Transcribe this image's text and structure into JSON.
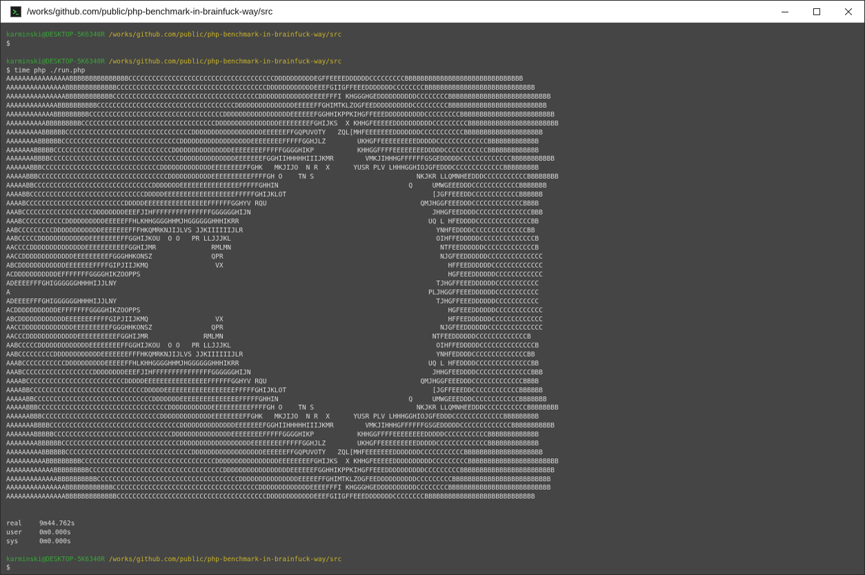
{
  "window": {
    "title": "/works/github.com/public/php-benchmark-in-brainfuck-way/src",
    "controls": [
      "minimize-icon",
      "maximize-icon",
      "close-icon"
    ]
  },
  "colors": {
    "prompt_user": "#3aa53a",
    "prompt_path": "#c9b42a",
    "text": "#d9d9d9",
    "background": "#454545"
  },
  "terminal": {
    "prompt1": {
      "user": "karminski@DESKTOP-5K6340R",
      "path": "/works/github.com/public/php-benchmark-in-brainfuck-way/src"
    },
    "prompt1_cmd": "$",
    "prompt2": {
      "user": "karminski@DESKTOP-5K6340R",
      "path": "/works/github.com/public/php-benchmark-in-brainfuck-way/src"
    },
    "prompt2_cmd": "$ time php ./run.php",
    "output": [
      "AAAAAAAAAAAAAAAABBBBBBBBBBBBBBBCCCCCCCCCCCCCCCCCCCCCCCCCCCCCCCCCCCCCDDDDDDDDDDEGFFEEEEDDDDDDCCCCCCCCCBBBBBBBBBBBBBBBBBBBBBBBBBBBBBB",
      "AAAAAAAAAAAAAAABBBBBBBBBBBBBCCCCCCCCCCCCCCCCCCCCCCCCCCCCCCCCCCCCCCDDDDDDDDDDDDEEEFGIIGFFEEEDDDDDDDCCCCCCCCBBBBBBBBBBBBBBBBBBBBBBBBBBBB",
      "AAAAAAAAAAAAAAABBBBBBBBBBBBCCCCCCCCCCCCCCCCCCCCCCCCCCCCCCCCCCCCCDDDDDDDDDDDDDEEEEFFFI KHGGGHGEDDDDDDDDDDCCCCCCCCBBBBBBBBBBBBBBBBBBBBBBBBBB",
      "AAAAAAAAAAAAABBBBBBBBBBCCCCCCCCCCCCCCCCCCCCCCCCCCCCCCCCCCCDDDDDDDDDDDDDDDEEEEEFFGHIMTKLZOGFEEDDDDDDDDDDCCCCCCCCCBBBBBBBBBBBBBBBBBBBBBBBBB",
      "AAAAAAAAAAAABBBBBBBBBCCCCCCCCCCCCCCCCCCCCCCCCCCCCCCCCCCDDDDDDDDDDDDDDDDDEEEEEEFGGHHIKPPKIHGFFEEEDDDDDDDDDDCCCCCCCCCBBBBBBBBBBBBBBBBBBBBBBBB",
      "AAAAAAAAAABBBBBBBBBCCCCCCCCCCCCCCCCCCCCCCCCCCCCCCCCCCDDDDDDDDDDDDDDDDEEEEEEEEFGHIJKS  X KHHGFEEEEEDDDDDDDDDDCCCCCCCCCBBBBBBBBBBBBBBBBBBBBBBB",
      "AAAAAAAAABBBBBBCCCCCCCCCCCCCCCCCCCCCCCCCCCCCCCCDDDDDDDDDDDDDDDDDDEEEEEEFFGQPUVOTY   ZQL[MHFEEEEEEEDDDDDDDCCCCCCCCCCCBBBBBBBBBBBBBBBBBBBB",
      "AAAAAAAABBBBBBCCCCCCCCCCCCCCCCCCCCCCCCCCCCCCDDDDDDDDDDDDDDDDDDEEEEEEEEFFFFFGGHJLZ        UKHGFFEEEEEEEEEDDDDDCCCCCCCCCCCCCBBBBBBBBBBBBB",
      "AAAAAAABBBBBCCCCCCCCCCCCCCCCCCCCCCCCCCCCCCDDDDDDDDDDDDDDDEEEEEEEEFFFFFGGGGHIKP           KHHGGFFFFEEEEEEEEDDDDDCCCCCCCCCCCBBBBBBBBBBBBB",
      "AAAAAAABBBBCCCCCCCCCCCCCCCCCCCCCCCCCCCCCCCCCDDDDDDDDDDDDDDEEEEEEEFGGHIIHHHHHIIIJKMR        VMKJIHHHGFFFFFFGSGEDDDDDCCCCCCCCCCCCCBBBBBBBBBBB",
      "AAAAAABBBCCCCCCCCCCCCCCCCCCCCCCCCCCCCCCDDDDDDDDDDDDDEEEEEEEEFFGHK   MKJIJO  N R  X      YUSR PLV LHHHGGHIOJGFEDDDCCCCCCCCCCCCCBBBBBBBBB",
      "AAAAABBBCCCCCCCCCCCCCCCCCCCCCCCCCCCCCCCCCDDDDDDDDDDDEEEEEEEEEEFFFFGH O    TN S                          NKJKR LLQMNHEEDDDCCCCCCCCCCCBBBBBBBB",
      "AAAAABBCCCCCCCCCCCCCCCCCCCCCCCCCCCCCCDDDDDDDEEEEEEEEEEEEEEEFFFFFGHHIN                                 Q     UMWGEEEDDDCCCCCCCCCCCCBBBBBBB",
      "AAAABBCCCCCCCCCCCCCCCCCCCCCCCCCCCCCDDDDDEEEEEEEEEEEEEEEEEEFFFFFGHIJKLOT                                     [JGFFEEEDDCCCCCCCCCCCCBBBBBB",
      "AAAABCCCCCCCCCCCCCCCCCCCCCCCCCDDDDDEEEEEEEEEEEEEEEEFFFFFFGGHYV RQU                                       QMJHGGFEEEDDDCCCCCCCCCCCCCBBBB",
      "AAABCCCCCCCCCCCCCCCCCCDDDDDDDDEEEFJIHFFFFFFFFFFFFFFFGGGGGGHIJN                                              JHHGFEEDDDDCCCCCCCCCCCCCCBBB",
      "AAABCCCCCCCCCCCDDDDDDDDDDEEEEEFFHLKHHGGGGHHMJHGGGGGGHHHIKRR                                                UQ L HFEDDDDCCCCCCCCCCCCCCBB",
      "AABCCCCCCCCCDDDDDDDDDDDDEEEEEEEFFFHKQMRKNJIJLVS JJKIIIIIIJLR                                                 YNHFEDDDDCCCCCCCCCCCCCCBB",
      "AABCCCCCDDDDDDDDDDDDDEEEEEEEEFFGGHIJKOU  O O   PR LLJJJKL                                                    OIHFFEDDDDDCCCCCCCCCCCCCCB",
      "AACCCCDDDDDDDDDDDDDDEEEEEEEEEEFGGHIJMR              RMLMN                                                     NTFEEDDDDDDCCCCCCCCCCCCCB",
      "AACCDDDDDDDDDDDDDEEEEEEEEEFGGGHHKONSZ               QPR                                                       NJGFEEDDDDDDCCCCCCCCCCCCCC",
      "ABCDDDDDDDDDDDDEEEEEEEFFFFGIPJIIJKMQ                 VX                                                         HFFEEDDDDDDCCCCCCCCCCCCC",
      "ACDDDDDDDDDDDEFFFFFFFGGGGHIKZOOPPS                                                                              HGFEEEDDDDDDCCCCCCCCCCCC",
      "ADEEEEFFFGHIGGGGGGHHHHIJJLNY                                                                                 TJHGFFEEEDDDDDDCCCCCCCCCCC",
      "A                                                                                                          PLJHGGFFEEEDDDDDDCCCCCCCCCCC",
      "ADEEEEFFFGHIGGGGGGHHHHIJJLNY                                                                                 TJHGFFEEEDDDDDDCCCCCCCCCCC",
      "ACDDDDDDDDDDDEFFFFFFFGGGGHIKZOOPPS                                                                              HGFEEEDDDDDDCCCCCCCCCCCC",
      "ABCDDDDDDDDDDDDEEEEEEEFFFFGIPJIIJKMQ                 VX                                                         HFFEEDDDDDDCCCCCCCCCCCCC",
      "AACCDDDDDDDDDDDDDEEEEEEEEEFGGGHHKONSZ               QPR                                                       NJGFEEDDDDDDCCCCCCCCCCCCCC",
      "AACCCDDDDDDDDDDDDDEEEEEEEEEEFGGHIJMR              RMLMN                                                     NTFEEDDDDDDCCCCCCCCCCCCCB",
      "AABCCCCCDDDDDDDDDDDDDEEEEEEEEFFGGHIJKOU  O O   PR LLJJJKL                                                    OIHFFEDDDDDCCCCCCCCCCCCCCB",
      "AABCCCCCCCCCDDDDDDDDDDDDEEEEEEEFFFHKQMRKNJIJLVS JJKIIIIIIJLR                                                 YNHFEDDDDCCCCCCCCCCCCCCBB",
      "AAABCCCCCCCCCCCDDDDDDDDDDEEEEEFFHLKHHGGGGHHMJHGGGGGGHHHIKRR                                                UQ L HFEDDDDCCCCCCCCCCCCCCBB",
      "AAABCCCCCCCCCCCCCCCCCCDDDDDDDDEEEFJIHFFFFFFFFFFFFFFFGGGGGGHIJN                                              JHHGFEEDDDDCCCCCCCCCCCCCCBBB",
      "AAAABCCCCCCCCCCCCCCCCCCCCCCCCCDDDDDEEEEEEEEEEEEEEEEFFFFFFGGHYV RQU                                       QMJHGGFEEEDDDCCCCCCCCCCCCCBBBB",
      "AAAABBCCCCCCCCCCCCCCCCCCCCCCCCCCCCCDDDDDEEEEEEEEEEEEEEEEEEFFFFFGHIJKLOT                                     [JGFFEEEDDCCCCCCCCCCCCBBBBBB",
      "AAAAABBCCCCCCCCCCCCCCCCCCCCCCCCCCCCCCDDDDDDDEEEEEEEEEEEEEEEFFFFFGHHIN                                 Q     UMWGEEEDDDCCCCCCCCCCCCBBBBBBB",
      "AAAAABBBCCCCCCCCCCCCCCCCCCCCCCCCCCCCCCCCCDDDDDDDDDDDEEEEEEEEEEFFFFGH O    TN S                          NKJKR LLQMNHEEDDDCCCCCCCCCCCBBBBBBBB",
      "AAAAAABBBCCCCCCCCCCCCCCCCCCCCCCCCCCCCCCDDDDDDDDDDDDDEEEEEEEEFFGHK   MKJIJO  N R  X      YUSR PLV LHHHGGHIOJGFEDDDCCCCCCCCCCCCCBBBBBBBBB",
      "AAAAAAABBBBCCCCCCCCCCCCCCCCCCCCCCCCCCCCCCCCCDDDDDDDDDDDDDDEEEEEEEFGGHIIHHHHHIIIJKMR        VMKJIHHHGFFFFFFGSGEDDDDDCCCCCCCCCCCCCBBBBBBBBBBB",
      "AAAAAAABBBBBCCCCCCCCCCCCCCCCCCCCCCCCCCCCCCDDDDDDDDDDDDDDDEEEEEEEEFFFFFGGGGHIKP           KHHGGFFFFEEEEEEEEDDDDDCCCCCCCCCCCBBBBBBBBBBBBB",
      "AAAAAAAABBBBBBCCCCCCCCCCCCCCCCCCCCCCCCCCCCCCDDDDDDDDDDDDDDDDDDEEEEEEEEFFFFFGGHJLZ        UKHGFFEEEEEEEEEDDDDDCCCCCCCCCCCCCBBBBBBBBBBBBB",
      "AAAAAAAAABBBBBBCCCCCCCCCCCCCCCCCCCCCCCCCCCCCCCCDDDDDDDDDDDDDDDDDDEEEEEEFFGQPUVOTY   ZQL[MHFEEEEEEEDDDDDDDCCCCCCCCCCCBBBBBBBBBBBBBBBBBBBB",
      "AAAAAAAAAABBBBBBBBBCCCCCCCCCCCCCCCCCCCCCCCCCCCCCCCCCCDDDDDDDDDDDDDDDDEEEEEEEEFGHIJKS  X KHHGFEEEEEDDDDDDDDDDCCCCCCCCCBBBBBBBBBBBBBBBBBBBBBBB",
      "AAAAAAAAAAAABBBBBBBBBCCCCCCCCCCCCCCCCCCCCCCCCCCCCCCCCCCDDDDDDDDDDDDDDDDDEEEEEEFGGHHIKPPKIHGFFEEEDDDDDDDDDDCCCCCCCCCBBBBBBBBBBBBBBBBBBBBBBBB",
      "AAAAAAAAAAAAABBBBBBBBBBCCCCCCCCCCCCCCCCCCCCCCCCCCCCCCCCCCCCDDDDDDDDDDDDDDDEEEEEFFGHIMTKLZOGFEEDDDDDDDDDDCCCCCCCCCBBBBBBBBBBBBBBBBBBBBBBBBB",
      "AAAAAAAAAAAAAAABBBBBBBBBBBBCCCCCCCCCCCCCCCCCCCCCCCCCCCCCCCCCCCCCDDDDDDDDDDDDDEEEEFFFI KHGGGHGEDDDDDDDDDDCCCCCCCCBBBBBBBBBBBBBBBBBBBBBBBBBB",
      "AAAAAAAAAAAAAAABBBBBBBBBBBBBCCCCCCCCCCCCCCCCCCCCCCCCCCCCCCCCCCCCCCDDDDDDDDDDDDEEEFGIIGFFEEEDDDDDDDCCCCCCCCBBBBBBBBBBBBBBBBBBBBBBBBBBBB"
    ],
    "timing": [
      {
        "label": "real",
        "value": "9m44.762s"
      },
      {
        "label": "user",
        "value": "0m0.000s"
      },
      {
        "label": "sys",
        "value": "0m0.000s"
      }
    ],
    "prompt3": {
      "user": "karminski@DESKTOP-5K6340R",
      "path": "/works/github.com/public/php-benchmark-in-brainfuck-way/src"
    },
    "prompt3_cmd": "$"
  }
}
